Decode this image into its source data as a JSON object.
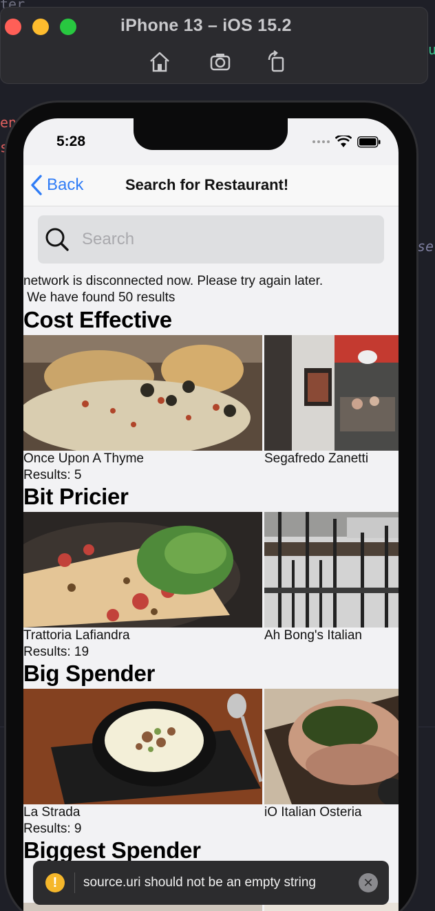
{
  "simulator": {
    "title": "iPhone 13 – iOS 15.2",
    "tools": [
      "home-icon",
      "screenshot-icon",
      "rotate-icon"
    ]
  },
  "status_bar": {
    "time": "5:28"
  },
  "nav": {
    "back_label": "Back",
    "title": "Search for Restaurant!"
  },
  "search": {
    "placeholder": "Search",
    "value": ""
  },
  "messages": {
    "network": "network is disconnected now. Please try again later.",
    "found": " We have found 50 results"
  },
  "sections": [
    {
      "title": "Cost Effective",
      "restaurants": [
        "Once Upon A Thyme",
        "Segafredo Zanetti"
      ],
      "results_label": "Results: 5"
    },
    {
      "title": "Bit Pricier",
      "restaurants": [
        "Trattoria Lafiandra",
        "Ah Bong's Italian"
      ],
      "results_label": "Results: 19"
    },
    {
      "title": "Big Spender",
      "restaurants": [
        "La Strada",
        "iO Italian Osteria"
      ],
      "results_label": "Results: 9"
    },
    {
      "title": "Biggest Spender"
    }
  ],
  "toast": {
    "message": "source.uri should not be an empty string",
    "icon": "warning-icon"
  },
  "colors": {
    "accent": "#2f7cf6",
    "warning": "#f5b72b"
  }
}
